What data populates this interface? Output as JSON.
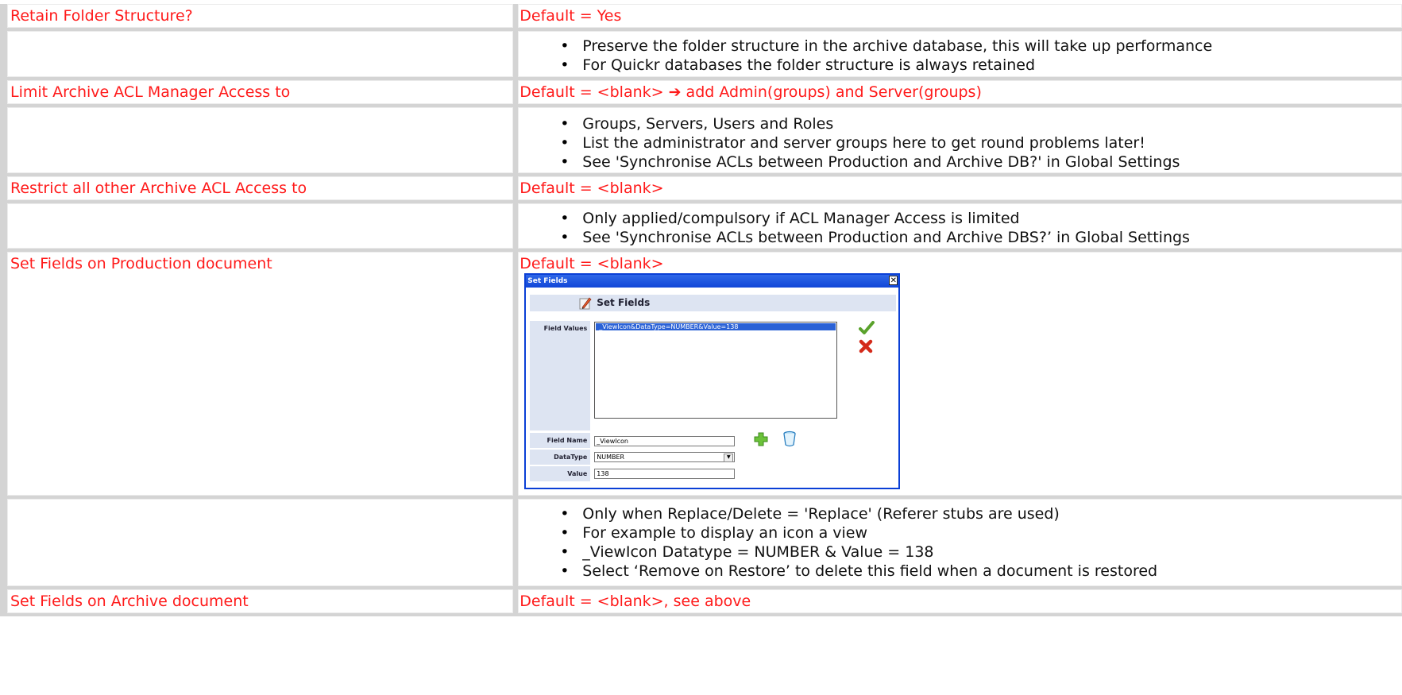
{
  "rows": {
    "r1": {
      "label": "Retain Folder Structure?",
      "default": "Default = Yes"
    },
    "r2": {
      "bullets": [
        "Preserve the folder structure in the archive database, this will take up performance",
        "For Quickr databases the folder structure is always retained"
      ]
    },
    "r3": {
      "label": "Limit Archive ACL Manager Access to",
      "default_prefix": "Default = <blank> ",
      "arrow": "➔",
      "default_suffix": " add Admin(groups) and Server(groups)"
    },
    "r4": {
      "bullets": [
        "Groups, Servers, Users and Roles",
        "List the administrator and server groups here to get round problems later!",
        "See 'Synchronise ACLs between Production and Archive DB?' in Global Settings"
      ]
    },
    "r5": {
      "label": "Restrict all other Archive ACL Access to",
      "default": "Default = <blank>"
    },
    "r6": {
      "bullets": [
        "Only applied/compulsory if ACL Manager Access is limited",
        "See 'Synchronise ACLs between Production and Archive DBS?’ in Global Settings"
      ]
    },
    "r7": {
      "label": "Set Fields on Production document",
      "default": "Default = <blank>"
    },
    "r8": {
      "bullets": [
        "Only when Replace/Delete = 'Replace' (Referer stubs are used)",
        "For example to display an icon a view",
        "_ViewIcon Datatype = NUMBER & Value = 138",
        "Select ‘Remove on Restore’ to delete this field when a document is restored"
      ]
    },
    "r9": {
      "label": "Set Fields on Archive document",
      "default": "Default = <blank>, see above"
    }
  },
  "dialog": {
    "window_title": "Set Fields",
    "close_glyph": "✕",
    "header": "Set Fields",
    "field_values_label": "Field Values",
    "field_values_item": "_ViewIcon&DataType=NUMBER&Value=138",
    "field_name_label": "Field Name",
    "field_name_value": "_ViewIcon",
    "datatype_label": "DataType",
    "datatype_value": "NUMBER",
    "value_label": "Value",
    "value_value": "138",
    "icons": [
      "pencil-icon",
      "check-icon",
      "cross-icon",
      "add-icon",
      "delete-icon"
    ],
    "colors": {
      "frame": "#0a3fd6",
      "label_bg": "#dde4f2",
      "selection": "#2b62d6"
    }
  },
  "colors": {
    "label_text": "#ff1a1a",
    "grid": "#d4d4d4"
  }
}
